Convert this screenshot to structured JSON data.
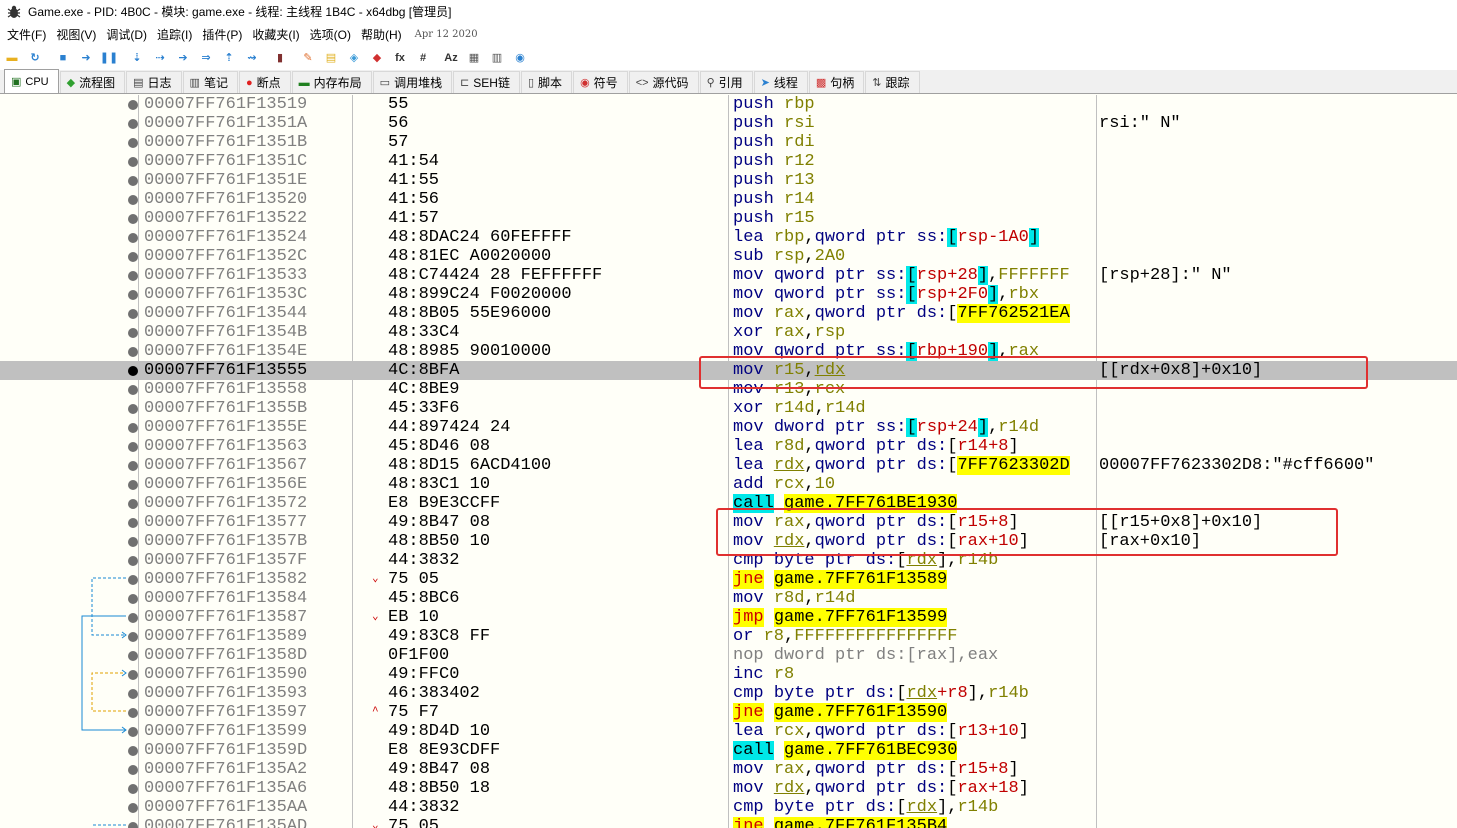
{
  "window": {
    "title": "Game.exe - PID: 4B0C - 模块: game.exe - 线程: 主线程 1B4C - x64dbg [管理员]"
  },
  "menu": {
    "items": [
      "文件(F)",
      "视图(V)",
      "调试(D)",
      "追踪(I)",
      "插件(P)",
      "收藏夹(I)",
      "选项(O)",
      "帮助(H)"
    ],
    "date": "Apr 12 2020"
  },
  "toolbar": {
    "icons": [
      "open-icon",
      "restart-icon",
      "stop-icon",
      "run-icon",
      "pause-icon",
      "step-into-icon",
      "step-over-icon",
      "trace-into-icon",
      "trace-over-icon",
      "execute-till-return-icon",
      "run-to-user-code-icon",
      "script-icon",
      "comment-icon",
      "label-icon",
      "bookmark-icon",
      "function-icon",
      "expression-icon",
      "hash-icon",
      "font-icon",
      "variables-icon",
      "calculator-icon",
      "about-icon"
    ],
    "labels": {
      "fx": "fx",
      "hash": "#",
      "font": "Az"
    }
  },
  "tabs": [
    {
      "label": "CPU",
      "icon": "cpu-icon",
      "active": true
    },
    {
      "label": "流程图",
      "icon": "graph-icon"
    },
    {
      "label": "日志",
      "icon": "log-icon"
    },
    {
      "label": "笔记",
      "icon": "notes-icon"
    },
    {
      "label": "断点",
      "icon": "breakpoint-icon"
    },
    {
      "label": "内存布局",
      "icon": "memory-map-icon"
    },
    {
      "label": "调用堆栈",
      "icon": "call-stack-icon"
    },
    {
      "label": "SEH链",
      "icon": "seh-icon"
    },
    {
      "label": "脚本",
      "icon": "script-icon"
    },
    {
      "label": "符号",
      "icon": "symbols-icon"
    },
    {
      "label": "源代码",
      "icon": "source-icon"
    },
    {
      "label": "引用",
      "icon": "references-icon"
    },
    {
      "label": "线程",
      "icon": "threads-icon"
    },
    {
      "label": "句柄",
      "icon": "handles-icon"
    },
    {
      "label": "跟踪",
      "icon": "trace-icon"
    }
  ],
  "colors": {
    "selected_row": "#c0c0c0",
    "annotation_box": "#e03030",
    "call_highlight": "#00e8e8",
    "jump_highlight": "#ffff00"
  },
  "disassembly": [
    {
      "addr": "00007FF761F13519",
      "bytes": "55",
      "dis": [
        [
          "mn",
          "push "
        ],
        [
          "rg",
          "rbp"
        ]
      ],
      "cmt": ""
    },
    {
      "addr": "00007FF761F1351A",
      "bytes": "56",
      "dis": [
        [
          "mn",
          "push "
        ],
        [
          "rg",
          "rsi"
        ]
      ],
      "cmt": "rsi:\" N\""
    },
    {
      "addr": "00007FF761F1351B",
      "bytes": "57",
      "dis": [
        [
          "mn",
          "push "
        ],
        [
          "rg",
          "rdi"
        ]
      ],
      "cmt": ""
    },
    {
      "addr": "00007FF761F1351C",
      "bytes": "41:54",
      "dis": [
        [
          "mn",
          "push "
        ],
        [
          "rg",
          "r12"
        ]
      ],
      "cmt": ""
    },
    {
      "addr": "00007FF761F1351E",
      "bytes": "41:55",
      "dis": [
        [
          "mn",
          "push "
        ],
        [
          "rg",
          "r13"
        ]
      ],
      "cmt": ""
    },
    {
      "addr": "00007FF761F13520",
      "bytes": "41:56",
      "dis": [
        [
          "mn",
          "push "
        ],
        [
          "rg",
          "r14"
        ]
      ],
      "cmt": ""
    },
    {
      "addr": "00007FF761F13522",
      "bytes": "41:57",
      "dis": [
        [
          "mn",
          "push "
        ],
        [
          "rg",
          "r15"
        ]
      ],
      "cmt": ""
    },
    {
      "addr": "00007FF761F13524",
      "bytes": "48:8DAC24 60FEFFFF",
      "dis": [
        [
          "mn",
          "lea "
        ],
        [
          "rg",
          "rbp"
        ],
        [
          "",
          ","
        ],
        [
          "pt",
          "qword ptr "
        ],
        [
          "sr",
          "ss:"
        ],
        [
          "br",
          "["
        ],
        [
          "rr",
          "rsp-1A0"
        ],
        [
          "br",
          "]"
        ]
      ],
      "cmt": ""
    },
    {
      "addr": "00007FF761F1352C",
      "bytes": "48:81EC A0020000",
      "dis": [
        [
          "mn",
          "sub "
        ],
        [
          "rg",
          "rsp"
        ],
        [
          "",
          ","
        ],
        [
          "nm",
          "2A0"
        ]
      ],
      "cmt": ""
    },
    {
      "addr": "00007FF761F13533",
      "bytes": "48:C74424 28 FEFFFFFF",
      "dis": [
        [
          "mn",
          "mov "
        ],
        [
          "pt",
          "qword ptr "
        ],
        [
          "sr",
          "ss:"
        ],
        [
          "br",
          "["
        ],
        [
          "rr",
          "rsp+28"
        ],
        [
          "br",
          "]"
        ],
        [
          "",
          ","
        ],
        [
          "nm",
          "FFFFFFF"
        ]
      ],
      "cmt": "[rsp+28]:\" N\""
    },
    {
      "addr": "00007FF761F1353C",
      "bytes": "48:899C24 F0020000",
      "dis": [
        [
          "mn",
          "mov "
        ],
        [
          "pt",
          "qword ptr "
        ],
        [
          "sr",
          "ss:"
        ],
        [
          "br",
          "["
        ],
        [
          "rr",
          "rsp+2F0"
        ],
        [
          "br",
          "]"
        ],
        [
          "",
          ","
        ],
        [
          "rg",
          "rbx"
        ]
      ],
      "cmt": ""
    },
    {
      "addr": "00007FF761F13544",
      "bytes": "48:8B05 55E96000",
      "dis": [
        [
          "mn",
          "mov "
        ],
        [
          "rg",
          "rax"
        ],
        [
          "",
          ","
        ],
        [
          "pt",
          "qword ptr "
        ],
        [
          "sr",
          "ds:"
        ],
        [
          "",
          "["
        ],
        [
          "yl",
          "7FF762521EA"
        ]
      ],
      "cmt": ""
    },
    {
      "addr": "00007FF761F1354B",
      "bytes": "48:33C4",
      "dis": [
        [
          "mn",
          "xor "
        ],
        [
          "rg",
          "rax"
        ],
        [
          "",
          ","
        ],
        [
          "rg",
          "rsp"
        ]
      ],
      "cmt": ""
    },
    {
      "addr": "00007FF761F1354E",
      "bytes": "48:8985 90010000",
      "dis": [
        [
          "mn",
          "mov "
        ],
        [
          "pt",
          "qword ptr "
        ],
        [
          "sr",
          "ss:"
        ],
        [
          "br",
          "["
        ],
        [
          "rr",
          "rbp+190"
        ],
        [
          "br",
          "]"
        ],
        [
          "",
          ","
        ],
        [
          "rg",
          "rax"
        ]
      ],
      "cmt": ""
    },
    {
      "addr": "00007FF761F13555",
      "bytes": "4C:8BFA",
      "dis": [
        [
          "mn",
          "mov "
        ],
        [
          "rg",
          "r15"
        ],
        [
          "",
          ","
        ],
        [
          "rgu",
          "rdx"
        ]
      ],
      "cmt": "[[rdx+0x8]+0x10]",
      "sel": true
    },
    {
      "addr": "00007FF761F13558",
      "bytes": "4C:8BE9",
      "dis": [
        [
          "mn",
          "mov "
        ],
        [
          "rg",
          "r13"
        ],
        [
          "",
          ","
        ],
        [
          "rg",
          "rcx"
        ]
      ],
      "cmt": ""
    },
    {
      "addr": "00007FF761F1355B",
      "bytes": "45:33F6",
      "dis": [
        [
          "mn",
          "xor "
        ],
        [
          "rg",
          "r14d"
        ],
        [
          "",
          ","
        ],
        [
          "rg",
          "r14d"
        ]
      ],
      "cmt": ""
    },
    {
      "addr": "00007FF761F1355E",
      "bytes": "44:897424 24",
      "dis": [
        [
          "mn",
          "mov "
        ],
        [
          "pt",
          "dword ptr "
        ],
        [
          "sr",
          "ss:"
        ],
        [
          "br",
          "["
        ],
        [
          "rr",
          "rsp+24"
        ],
        [
          "br",
          "]"
        ],
        [
          "",
          ","
        ],
        [
          "rg",
          "r14d"
        ]
      ],
      "cmt": ""
    },
    {
      "addr": "00007FF761F13563",
      "bytes": "45:8D46 08",
      "dis": [
        [
          "mn",
          "lea "
        ],
        [
          "rg",
          "r8d"
        ],
        [
          "",
          ","
        ],
        [
          "pt",
          "qword ptr "
        ],
        [
          "sr",
          "ds:"
        ],
        [
          "",
          "["
        ],
        [
          "rr",
          "r14+8"
        ],
        [
          "",
          "]"
        ]
      ],
      "cmt": ""
    },
    {
      "addr": "00007FF761F13567",
      "bytes": "48:8D15 6ACD4100",
      "dis": [
        [
          "mn",
          "lea "
        ],
        [
          "rgu",
          "rdx"
        ],
        [
          "",
          ","
        ],
        [
          "pt",
          "qword ptr "
        ],
        [
          "sr",
          "ds:"
        ],
        [
          "",
          "["
        ],
        [
          "yl",
          "7FF7623302D"
        ]
      ],
      "cmt": "00007FF7623302D8:\"#cff6600\""
    },
    {
      "addr": "00007FF761F1356E",
      "bytes": "48:83C1 10",
      "dis": [
        [
          "mn",
          "add "
        ],
        [
          "rg",
          "rcx"
        ],
        [
          "",
          ","
        ],
        [
          "nm",
          "10"
        ]
      ],
      "cmt": ""
    },
    {
      "addr": "00007FF761F13572",
      "bytes": "E8 B9E3CCFF",
      "dis": [
        [
          "mc",
          "call"
        ],
        [
          "",
          " "
        ],
        [
          "yl",
          "game.7FF761BE1930"
        ]
      ],
      "cmt": ""
    },
    {
      "addr": "00007FF761F13577",
      "bytes": "49:8B47 08",
      "dis": [
        [
          "mn",
          "mov "
        ],
        [
          "rg",
          "rax"
        ],
        [
          "",
          ","
        ],
        [
          "pt",
          "qword ptr "
        ],
        [
          "sr",
          "ds:"
        ],
        [
          "",
          "["
        ],
        [
          "rr",
          "r15+8"
        ],
        [
          "",
          "]"
        ]
      ],
      "cmt": "[[r15+0x8]+0x10]"
    },
    {
      "addr": "00007FF761F1357B",
      "bytes": "48:8B50 10",
      "dis": [
        [
          "mn",
          "mov "
        ],
        [
          "rgu",
          "rdx"
        ],
        [
          "",
          ","
        ],
        [
          "pt",
          "qword ptr "
        ],
        [
          "sr",
          "ds:"
        ],
        [
          "",
          "["
        ],
        [
          "rr",
          "rax+10"
        ],
        [
          "",
          "]"
        ]
      ],
      "cmt": "[rax+0x10]"
    },
    {
      "addr": "00007FF761F1357F",
      "bytes": "44:3832",
      "dis": [
        [
          "mn",
          "cmp "
        ],
        [
          "pt",
          "byte ptr "
        ],
        [
          "sr",
          "ds:"
        ],
        [
          "",
          "["
        ],
        [
          "rgu",
          "rdx"
        ],
        [
          "",
          "]"
        ],
        [
          "",
          ","
        ],
        [
          "rg",
          "r14b"
        ]
      ],
      "cmt": ""
    },
    {
      "addr": "00007FF761F13582",
      "bytes": "75 05",
      "arrow": "⌄",
      "dis": [
        [
          "mj",
          "jne"
        ],
        [
          "",
          " "
        ],
        [
          "yl",
          "game.7FF761F13589"
        ]
      ],
      "cmt": ""
    },
    {
      "addr": "00007FF761F13584",
      "bytes": "45:8BC6",
      "dis": [
        [
          "mn",
          "mov "
        ],
        [
          "rg",
          "r8d"
        ],
        [
          "",
          ","
        ],
        [
          "rg",
          "r14d"
        ]
      ],
      "cmt": ""
    },
    {
      "addr": "00007FF761F13587",
      "bytes": "EB 10",
      "arrow": "⌄",
      "dis": [
        [
          "mj",
          "jmp"
        ],
        [
          "",
          " "
        ],
        [
          "yl",
          "game.7FF761F13599"
        ]
      ],
      "cmt": ""
    },
    {
      "addr": "00007FF761F13589",
      "bytes": "49:83C8 FF",
      "dis": [
        [
          "mn",
          "or "
        ],
        [
          "rg",
          "r8"
        ],
        [
          "",
          ","
        ],
        [
          "nm",
          "FFFFFFFFFFFFFFFF"
        ]
      ],
      "cmt": ""
    },
    {
      "addr": "00007FF761F1358D",
      "bytes": "0F1F00",
      "dis": [
        [
          "mk",
          "nop dword ptr ds:[rax],eax"
        ]
      ],
      "cmt": ""
    },
    {
      "addr": "00007FF761F13590",
      "bytes": "49:FFC0",
      "dis": [
        [
          "mn",
          "inc "
        ],
        [
          "rg",
          "r8"
        ]
      ],
      "cmt": ""
    },
    {
      "addr": "00007FF761F13593",
      "bytes": "46:383402",
      "dis": [
        [
          "mn",
          "cmp "
        ],
        [
          "pt",
          "byte ptr "
        ],
        [
          "sr",
          "ds:"
        ],
        [
          "",
          "["
        ],
        [
          "rgu",
          "rdx"
        ],
        [
          "rr",
          "+r8"
        ],
        [
          "",
          "]"
        ],
        [
          "",
          ","
        ],
        [
          "rg",
          "r14b"
        ]
      ],
      "cmt": ""
    },
    {
      "addr": "00007FF761F13597",
      "bytes": "75 F7",
      "arrow": "^",
      "dis": [
        [
          "mj",
          "jne"
        ],
        [
          "",
          " "
        ],
        [
          "yl",
          "game.7FF761F13590"
        ]
      ],
      "cmt": ""
    },
    {
      "addr": "00007FF761F13599",
      "bytes": "49:8D4D 10",
      "dis": [
        [
          "mn",
          "lea "
        ],
        [
          "rg",
          "rcx"
        ],
        [
          "",
          ","
        ],
        [
          "pt",
          "qword ptr "
        ],
        [
          "sr",
          "ds:"
        ],
        [
          "",
          "["
        ],
        [
          "rr",
          "r13+10"
        ],
        [
          "",
          "]"
        ]
      ],
      "cmt": ""
    },
    {
      "addr": "00007FF761F1359D",
      "bytes": "E8 8E93CDFF",
      "dis": [
        [
          "mc",
          "call"
        ],
        [
          "",
          " "
        ],
        [
          "yl",
          "game.7FF761BEC930"
        ]
      ],
      "cmt": ""
    },
    {
      "addr": "00007FF761F135A2",
      "bytes": "49:8B47 08",
      "dis": [
        [
          "mn",
          "mov "
        ],
        [
          "rg",
          "rax"
        ],
        [
          "",
          ","
        ],
        [
          "pt",
          "qword ptr "
        ],
        [
          "sr",
          "ds:"
        ],
        [
          "",
          "["
        ],
        [
          "rr",
          "r15+8"
        ],
        [
          "",
          "]"
        ]
      ],
      "cmt": ""
    },
    {
      "addr": "00007FF761F135A6",
      "bytes": "48:8B50 18",
      "dis": [
        [
          "mn",
          "mov "
        ],
        [
          "rgu",
          "rdx"
        ],
        [
          "",
          ","
        ],
        [
          "pt",
          "qword ptr "
        ],
        [
          "sr",
          "ds:"
        ],
        [
          "",
          "["
        ],
        [
          "rr",
          "rax+18"
        ],
        [
          "",
          "]"
        ]
      ],
      "cmt": ""
    },
    {
      "addr": "00007FF761F135AA",
      "bytes": "44:3832",
      "dis": [
        [
          "mn",
          "cmp "
        ],
        [
          "pt",
          "byte ptr "
        ],
        [
          "sr",
          "ds:"
        ],
        [
          "",
          "["
        ],
        [
          "rgu",
          "rdx"
        ],
        [
          "",
          "]"
        ],
        [
          "",
          ","
        ],
        [
          "rg",
          "r14b"
        ]
      ],
      "cmt": ""
    },
    {
      "addr": "00007FF761F135AD",
      "bytes": "75 05",
      "arrow": "⌄",
      "dis": [
        [
          "mj",
          "jne"
        ],
        [
          "",
          " "
        ],
        [
          "yl",
          "game.7FF761F135B4"
        ]
      ],
      "cmt": ""
    }
  ]
}
